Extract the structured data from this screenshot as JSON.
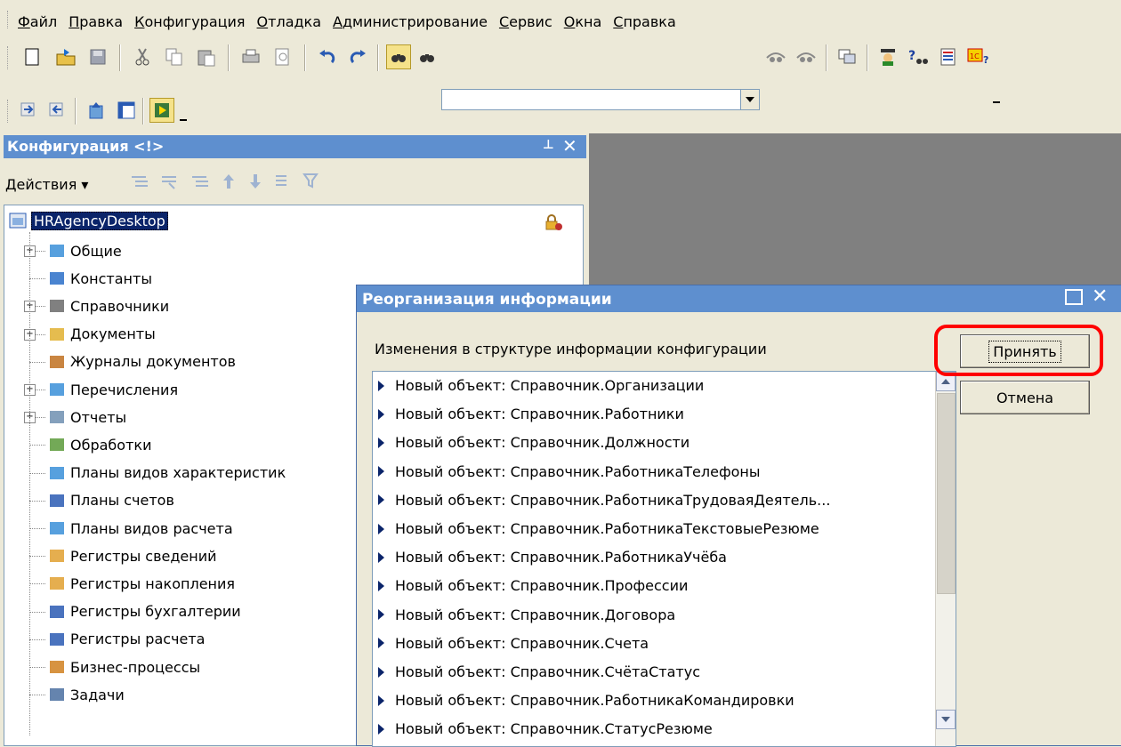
{
  "menu": [
    "Файл",
    "Правка",
    "Конфигурация",
    "Отладка",
    "Администрирование",
    "Сервис",
    "Окна",
    "Справка"
  ],
  "toolbar": {
    "search_value": ""
  },
  "config_panel": {
    "title": "Конфигурация <!>",
    "actions_label": "Действия ▾",
    "root": "HRAgencyDesktop",
    "items": [
      {
        "label": "Общие",
        "expand": true
      },
      {
        "label": "Константы",
        "expand": false
      },
      {
        "label": "Справочники",
        "expand": true
      },
      {
        "label": "Документы",
        "expand": true
      },
      {
        "label": "Журналы документов",
        "expand": false
      },
      {
        "label": "Перечисления",
        "expand": true
      },
      {
        "label": "Отчеты",
        "expand": true
      },
      {
        "label": "Обработки",
        "expand": false
      },
      {
        "label": "Планы видов характеристик",
        "expand": false
      },
      {
        "label": "Планы счетов",
        "expand": false
      },
      {
        "label": "Планы видов расчета",
        "expand": false
      },
      {
        "label": "Регистры сведений",
        "expand": false
      },
      {
        "label": "Регистры накопления",
        "expand": false
      },
      {
        "label": "Регистры бухгалтерии",
        "expand": false
      },
      {
        "label": "Регистры расчета",
        "expand": false
      },
      {
        "label": "Бизнес-процессы",
        "expand": false
      },
      {
        "label": "Задачи",
        "expand": false
      }
    ]
  },
  "dialog": {
    "title": "Реорганизация информации",
    "caption": "Изменения в структуре информации конфигурации",
    "accept": "Принять",
    "cancel": "Отмена",
    "changes": [
      "Новый объект: Справочник.Организации",
      "Новый объект: Справочник.Работники",
      "Новый объект: Справочник.Должности",
      "Новый объект: Справочник.РаботникаТелефоны",
      "Новый объект: Справочник.РаботникаТрудоваяДеятель...",
      "Новый объект: Справочник.РаботникаТекстовыеРезюме",
      "Новый объект: Справочник.РаботникаУчёба",
      "Новый объект: Справочник.Профессии",
      "Новый объект: Справочник.Договора",
      "Новый объект: Справочник.Счета",
      "Новый объект: Справочник.СчётаСтатус",
      "Новый объект: Справочник.РаботникаКомандировки",
      "Новый объект: Справочник.СтатусРезюме"
    ]
  },
  "colors": {
    "titlebar": "#5e8fcf",
    "highlight": "#ff0000"
  }
}
